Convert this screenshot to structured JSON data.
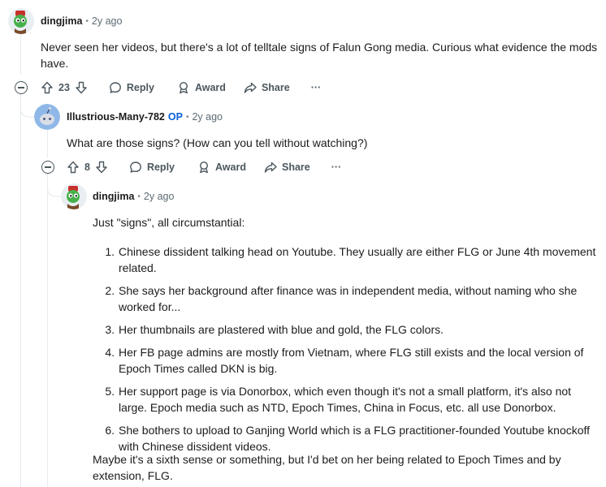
{
  "comments": [
    {
      "author": "dingjima",
      "time": "2y ago",
      "body": "Never seen her videos, but there's a lot of telltale signs of Falun Gong media. Curious what evidence the mods have.",
      "score": "23"
    },
    {
      "author": "Illustrious-Many-782",
      "op_label": "OP",
      "time": "2y ago",
      "body": "What are those signs? (How can you tell without watching?)",
      "score": "8"
    },
    {
      "author": "dingjima",
      "time": "2y ago",
      "intro": "Just \"signs\", all circumstantial:",
      "list": [
        {
          "num": "1.",
          "text": "Chinese dissident talking head on Youtube. They usually are either FLG or June 4th movement related."
        },
        {
          "num": "2.",
          "text": "She says her background after finance was in independent media, without naming who she worked for..."
        },
        {
          "num": "3.",
          "text": "Her thumbnails are plastered with blue and gold, the FLG colors."
        },
        {
          "num": "4.",
          "text": "Her FB page admins are mostly from Vietnam, where FLG still exists and the local version of Epoch Times called DKN is big."
        },
        {
          "num": "5.",
          "text": "Her support page is via Donorbox, which even though it's not a small platform, it's also not large. Epoch media such as NTD, Epoch Times, China in Focus, etc. all use Donorbox."
        },
        {
          "num": "6.",
          "text": "She bothers to upload to Ganjing World which is a FLG practitioner-founded Youtube knockoff with Chinese dissident videos."
        }
      ],
      "outro": "Maybe it's a sixth sense or something, but I'd bet on her being related to Epoch Times and by extension, FLG."
    }
  ],
  "actions": {
    "reply": "Reply",
    "award": "Award",
    "share": "Share",
    "more": "···"
  },
  "icons": {
    "upvote": "upvote-icon",
    "downvote": "downvote-icon",
    "reply": "comment-bubble-icon",
    "award": "award-icon",
    "share": "share-arrow-icon",
    "more": "ellipsis-icon",
    "collapse": "collapse-minus-icon"
  },
  "colors": {
    "op": "#0a5fd6",
    "text": "#1c1c1c",
    "muted": "#5c6c74",
    "thread_line": "#e5ebee"
  }
}
